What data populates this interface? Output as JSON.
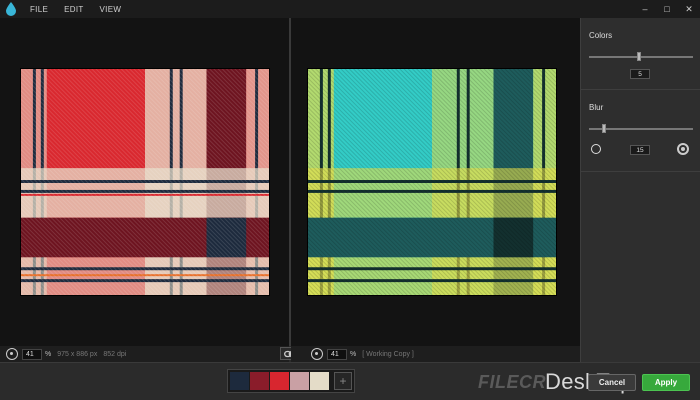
{
  "menu": {
    "items": [
      "FILE",
      "EDIT",
      "VIEW"
    ]
  },
  "window": {
    "minimize": "–",
    "maximize": "□",
    "close": "✕"
  },
  "left_view": {
    "zoom_value": "41",
    "zoom_unit": "%",
    "dimensions": "975 x 886 px",
    "dpi": "852 dpi"
  },
  "right_view": {
    "zoom_value": "41",
    "zoom_unit": "%",
    "label": "[ Working Copy ]"
  },
  "sidebar": {
    "colors": {
      "title": "Colors",
      "value": "5",
      "level": 0.48
    },
    "blur": {
      "title": "Blur",
      "value": "15",
      "level": 0.14
    }
  },
  "palette": {
    "swatches": [
      "#1d2a3d",
      "#8a1c2a",
      "#d8262f",
      "#c9a0a4",
      "#e4dcc8"
    ],
    "add_label": "+"
  },
  "buttons": {
    "cancel": "Cancel",
    "apply": "Apply"
  },
  "watermark": {
    "filecr": "FILECR",
    "desktop": "DeskTop"
  },
  "colors": {
    "original_base": "#d9282f",
    "original_dark": "#6e1420",
    "original_navy": "#1d2a3d",
    "original_cream": "#e7dec9",
    "working_base": "#33ccc6",
    "working_dark": "#1e5c5c",
    "working_yellow": "#e8e04a",
    "apply_green": "#37a93c"
  }
}
